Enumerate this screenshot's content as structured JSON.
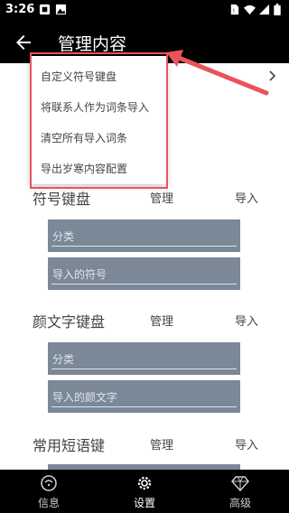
{
  "status_bar": {
    "time": "3:26",
    "icons": [
      "notification-icon",
      "image-icon",
      "sim-icon",
      "wifi-icon",
      "signal-icon",
      "battery-icon"
    ]
  },
  "app_bar": {
    "title": "管理内容",
    "back_icon": "arrow-left-icon"
  },
  "menu": {
    "items": [
      "自定义符号键盘",
      "将联系人作为词条导入",
      "清空所有导入词条",
      "导出岁寒内容配置"
    ]
  },
  "sections": [
    {
      "title": "符号键盘",
      "manage": "管理",
      "import": "导入",
      "fields": [
        "分类",
        "导入的符号"
      ]
    },
    {
      "title": "颜文字键盘",
      "manage": "管理",
      "import": "导入",
      "fields": [
        "分类",
        "导入的颜文字"
      ]
    },
    {
      "title": "常用短语键",
      "manage": "管理",
      "import": "导入",
      "fields": []
    }
  ],
  "bottom_nav": {
    "items": [
      {
        "label": "信息",
        "icon": "message-icon"
      },
      {
        "label": "设置",
        "icon": "gear-icon",
        "active": true
      },
      {
        "label": "高级",
        "icon": "diamond-icon"
      }
    ]
  },
  "colors": {
    "bar": "#000000",
    "field": "#7a8898",
    "highlight": "#e8545a"
  }
}
